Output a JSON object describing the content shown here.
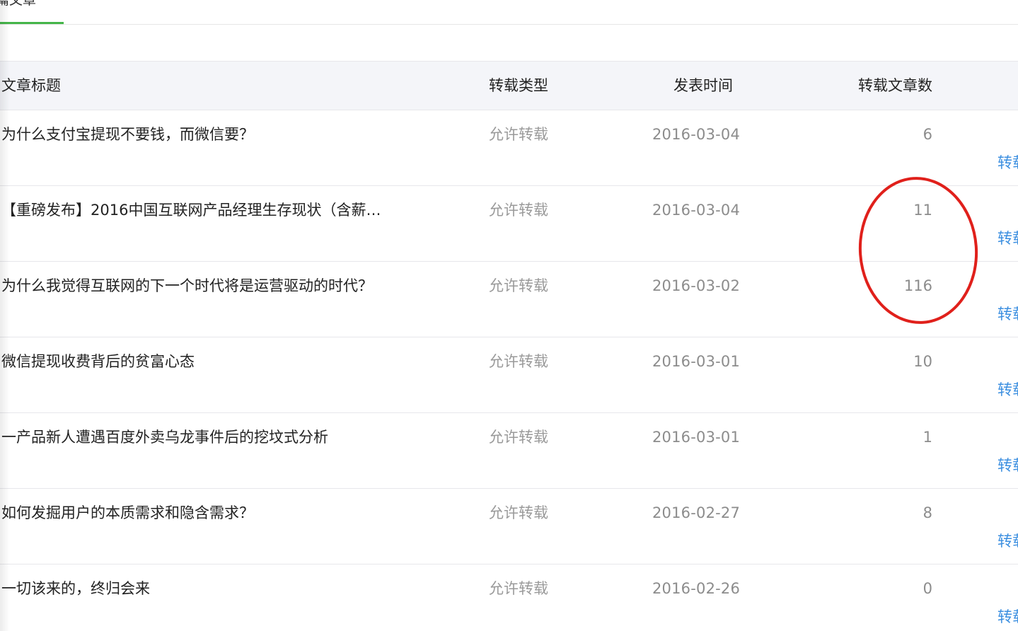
{
  "tabs": {
    "active_label": "篇文章"
  },
  "table": {
    "headers": {
      "title": "文章标题",
      "type": "转载类型",
      "time": "发表时间",
      "count": "转载文章数"
    },
    "rows": [
      {
        "title": "为什么支付宝提现不要钱，而微信要？",
        "type": "允许转载",
        "time": "2016-03-04",
        "count": "6",
        "action": "转载"
      },
      {
        "title": "【重磅发布】2016中国互联网产品经理生存现状（含薪…",
        "type": "允许转载",
        "time": "2016-03-04",
        "count": "11",
        "action": "转载"
      },
      {
        "title": "为什么我觉得互联网的下一个时代将是运营驱动的时代？",
        "type": "允许转载",
        "time": "2016-03-02",
        "count": "116",
        "action": "转载"
      },
      {
        "title": "微信提现收费背后的贫富心态",
        "type": "允许转载",
        "time": "2016-03-01",
        "count": "10",
        "action": "转载"
      },
      {
        "title": "一产品新人遭遇百度外卖乌龙事件后的挖坟式分析",
        "type": "允许转载",
        "time": "2016-03-01",
        "count": "1",
        "action": "转载"
      },
      {
        "title": "如何发掘用户的本质需求和隐含需求？",
        "type": "允许转载",
        "time": "2016-02-27",
        "count": "8",
        "action": "转载"
      },
      {
        "title": "一切该来的，终归会来",
        "type": "允许转载",
        "time": "2016-02-26",
        "count": "0",
        "action": "转载"
      }
    ]
  },
  "colors": {
    "tab_underline": "#44b549",
    "header_bg": "#f4f5f9",
    "link": "#3c8fe0",
    "annotation": "#e0201b"
  }
}
